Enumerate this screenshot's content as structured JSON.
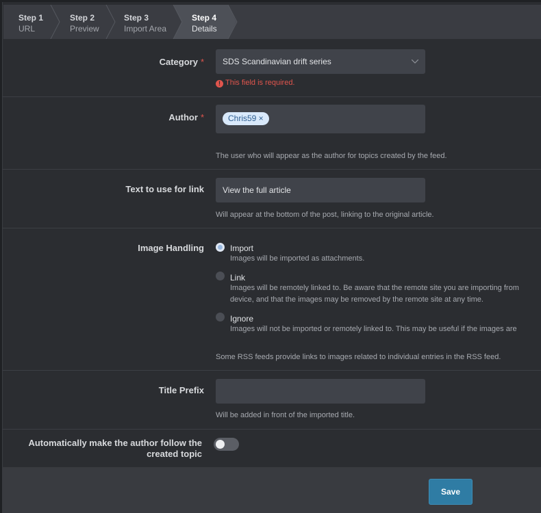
{
  "steps": [
    {
      "num": "Step 1",
      "sub": "URL"
    },
    {
      "num": "Step 2",
      "sub": "Preview"
    },
    {
      "num": "Step 3",
      "sub": "Import Area"
    },
    {
      "num": "Step 4",
      "sub": "Details"
    }
  ],
  "category": {
    "label": "Category",
    "required": "*",
    "value": "SDS Scandinavian drift series",
    "error": "This field is required."
  },
  "author": {
    "label": "Author",
    "required": "*",
    "chip": "Chris59 ×",
    "help": "The user who will appear as the author for topics created by the feed."
  },
  "link_text": {
    "label": "Text to use for link",
    "value": "View the full article",
    "help": "Will appear at the bottom of the post, linking to the original article."
  },
  "image_handling": {
    "label": "Image Handling",
    "options": [
      {
        "label": "Import",
        "help": "Images will be imported as attachments.",
        "selected": true
      },
      {
        "label": "Link",
        "help1": "Images will be remotely linked to. Be aware that the remote site you are importing from",
        "help2": "device, and that the images may be removed by the remote site at any time.",
        "selected": false
      },
      {
        "label": "Ignore",
        "help": "Images will not be imported or remotely linked to. This may be useful if the images are",
        "selected": false
      }
    ],
    "help": "Some RSS feeds provide links to images related to individual entries in the RSS feed."
  },
  "title_prefix": {
    "label": "Title Prefix",
    "value": "",
    "help": "Will be added in front of the imported title."
  },
  "follow": {
    "label_line1": "Automatically make the author follow the",
    "label_line2": "created topic",
    "enabled": false
  },
  "footer": {
    "save_label": "Save"
  }
}
